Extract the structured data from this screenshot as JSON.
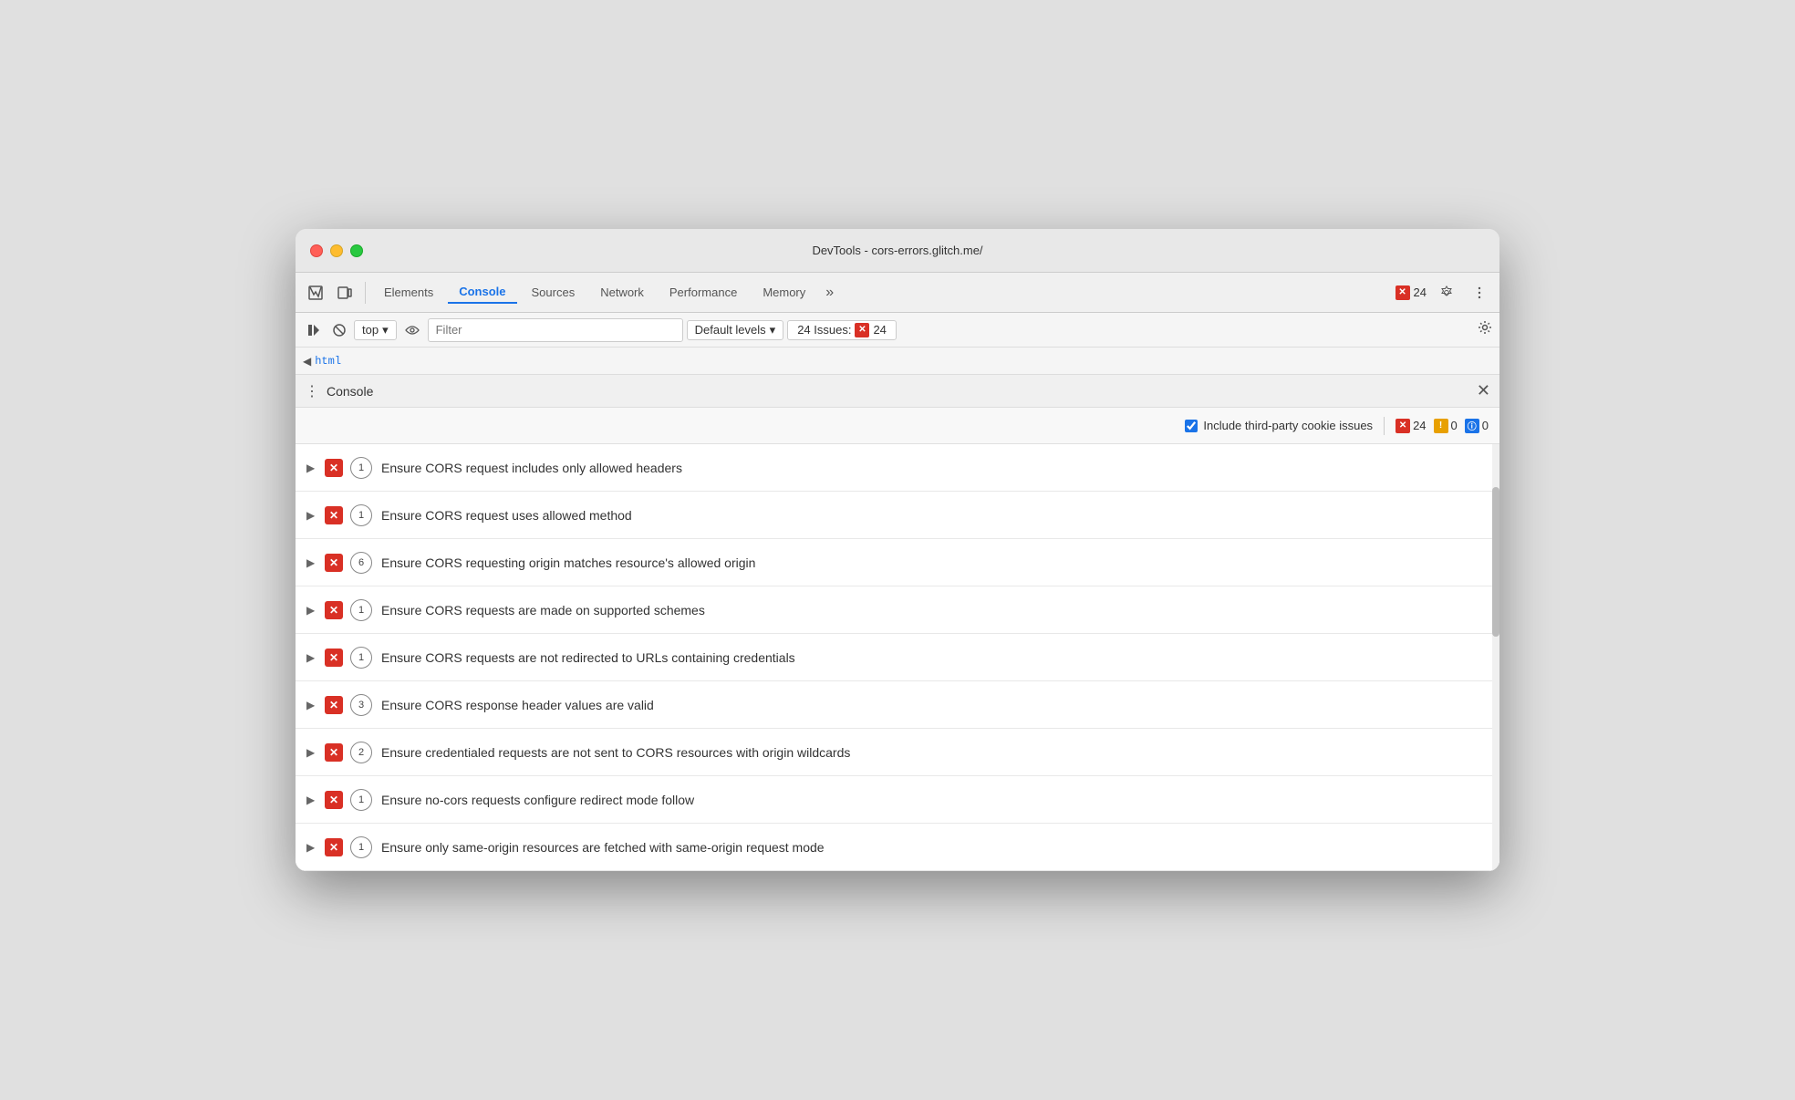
{
  "window": {
    "title": "DevTools - cors-errors.glitch.me/"
  },
  "tabs": [
    {
      "id": "elements",
      "label": "Elements",
      "active": false
    },
    {
      "id": "console",
      "label": "Console",
      "active": true
    },
    {
      "id": "sources",
      "label": "Sources",
      "active": false
    },
    {
      "id": "network",
      "label": "Network",
      "active": false
    },
    {
      "id": "performance",
      "label": "Performance",
      "active": false
    },
    {
      "id": "memory",
      "label": "Memory",
      "active": false
    }
  ],
  "toolbar": {
    "error_count": "24",
    "more_tabs_label": "»"
  },
  "console_toolbar": {
    "top_label": "top",
    "filter_placeholder": "Filter",
    "levels_label": "Default levels",
    "issues_label": "24 Issues:",
    "issues_count": "24"
  },
  "breadcrumb": {
    "text": "html"
  },
  "console_panel": {
    "title": "Console",
    "cookie_label": "Include third-party cookie issues",
    "error_count": "24",
    "warning_count": "0",
    "info_count": "0"
  },
  "issues": [
    {
      "text": "Ensure CORS request includes only allowed headers",
      "count": "1",
      "icon": "×"
    },
    {
      "text": "Ensure CORS request uses allowed method",
      "count": "1",
      "icon": "×"
    },
    {
      "text": "Ensure CORS requesting origin matches resource's allowed origin",
      "count": "6",
      "icon": "×"
    },
    {
      "text": "Ensure CORS requests are made on supported schemes",
      "count": "1",
      "icon": "×"
    },
    {
      "text": "Ensure CORS requests are not redirected to URLs containing credentials",
      "count": "1",
      "icon": "×"
    },
    {
      "text": "Ensure CORS response header values are valid",
      "count": "3",
      "icon": "×"
    },
    {
      "text": "Ensure credentialed requests are not sent to CORS resources with origin wildcards",
      "count": "2",
      "icon": "×"
    },
    {
      "text": "Ensure no-cors requests configure redirect mode follow",
      "count": "1",
      "icon": "×"
    },
    {
      "text": "Ensure only same-origin resources are fetched with same-origin request mode",
      "count": "1",
      "icon": "×"
    }
  ]
}
